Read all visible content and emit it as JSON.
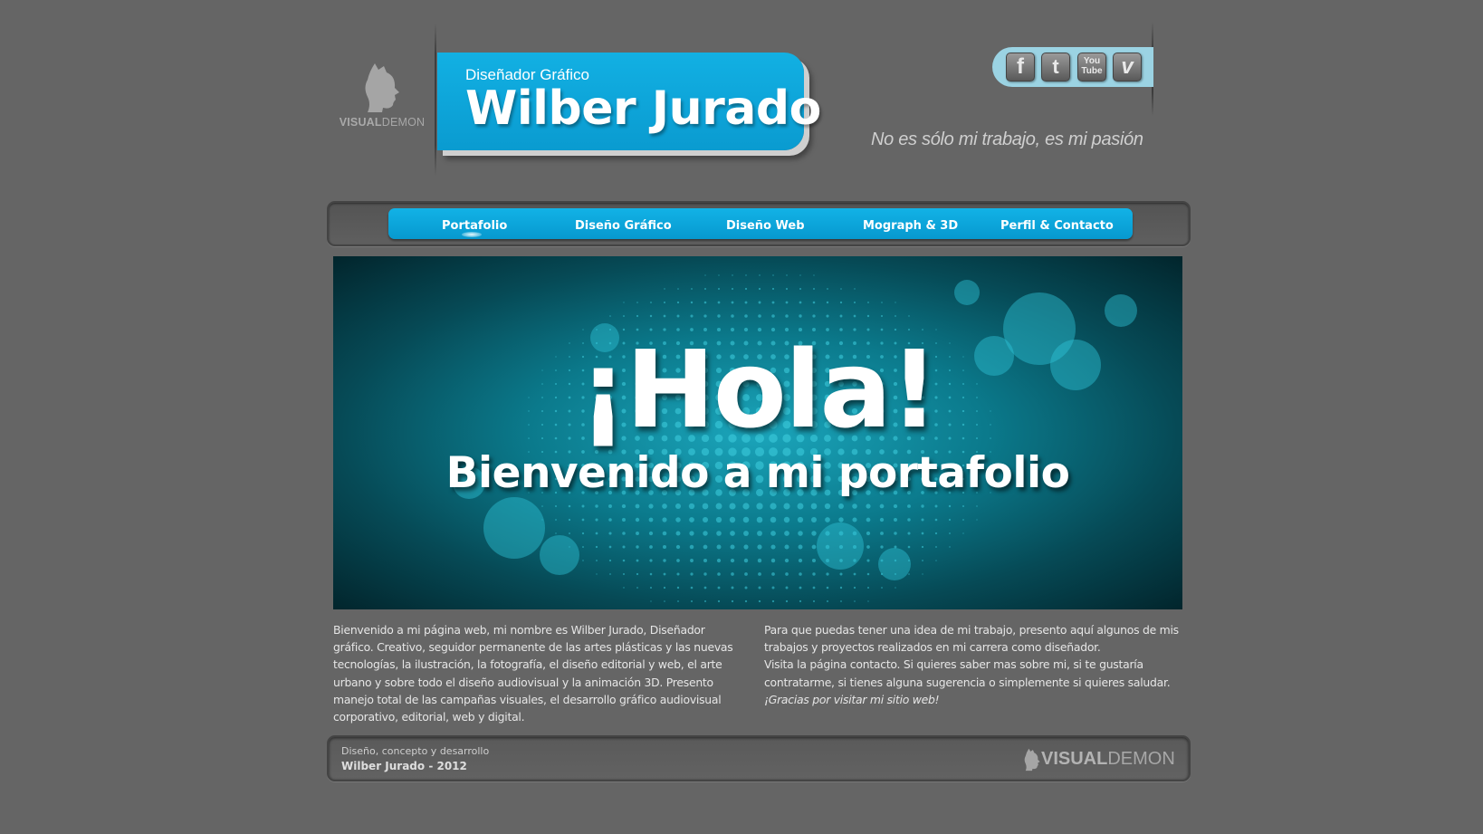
{
  "colors": {
    "background": "#656565",
    "accent": "#0aa5da",
    "social_bar": "#9bd3e3"
  },
  "logo": {
    "brand_bold": "VISUAL",
    "brand_light": "DEMON",
    "icon": "demon-head-icon"
  },
  "header": {
    "subtitle": "Diseñador Gráfico",
    "name": "Wilber Jurado",
    "tagline": "No es sólo mi trabajo, es mi pasión"
  },
  "social": {
    "facebook": {
      "icon": "facebook-icon",
      "glyph": "f"
    },
    "twitter": {
      "icon": "twitter-icon",
      "glyph": "t"
    },
    "youtube": {
      "icon": "youtube-icon",
      "glyph_top": "You",
      "glyph_bottom": "Tube"
    },
    "vimeo": {
      "icon": "vimeo-icon",
      "glyph": "v"
    }
  },
  "nav": {
    "items": [
      {
        "label": "Portafolio",
        "active": true
      },
      {
        "label": "Diseño Gráfico"
      },
      {
        "label": "Diseño Web"
      },
      {
        "label": "Mograph & 3D"
      },
      {
        "label": "Perfil & Contacto"
      }
    ]
  },
  "banner": {
    "title": "¡Hola!",
    "subtitle": "Bienvenido a mi portafolio"
  },
  "intro": {
    "left": "Bienvenido a mi página web, mi nombre es Wilber Jurado, Diseñador gráfico. Creativo, seguidor permanente de las artes plásticas y las nuevas tecnologías, la ilustración, la fotografía, el diseño editorial y web, el arte urbano y sobre todo el diseño audiovisual y la animación 3D. Presento manejo total de las campañas visuales, el desarrollo gráfico audiovisual corporativo, editorial, web y digital.",
    "right_p1": "Para que puedas tener una idea de mi trabajo, presento aquí algunos de mis trabajos y proyectos realizados en mi carrera como diseñador.",
    "right_p2": "Visita la página contacto.  Si quieres saber mas sobre mi, si te gustaría contratarme, si tienes alguna sugerencia o simplemente si  quieres saludar.",
    "right_thanks": "¡Gracias por visitar mi sitio web!"
  },
  "footer": {
    "line1": "Diseño, concepto y desarrollo",
    "line2": "Wilber Jurado - 2012",
    "brand_bold": "VISUAL",
    "brand_light": "DEMON"
  }
}
